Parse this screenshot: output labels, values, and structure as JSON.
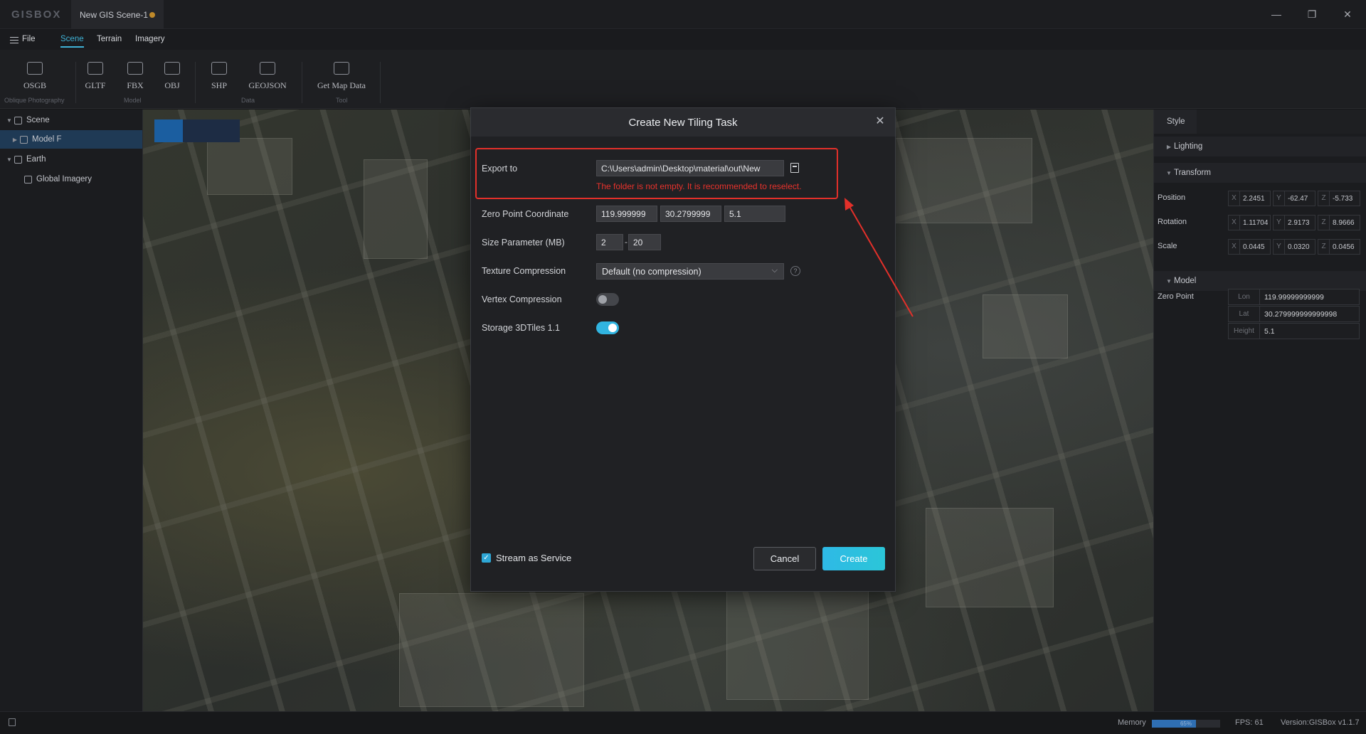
{
  "app": {
    "logo": "GISBOX",
    "doc_tab": "New GIS Scene-1",
    "window_controls": {
      "minimize": "—",
      "restore": "❐",
      "close": "✕"
    }
  },
  "menu": {
    "file": "File",
    "tabs": [
      "Scene",
      "Terrain",
      "Imagery"
    ],
    "active_tab": "Scene"
  },
  "ribbon": {
    "tools": [
      "OSGB",
      "GLTF",
      "FBX",
      "OBJ",
      "SHP",
      "GEOJSON",
      "Get Map Data"
    ],
    "groups": [
      "Oblique Photography",
      "Model",
      "Data",
      "Tool"
    ]
  },
  "tree": {
    "scene": "Scene",
    "model": "Model F",
    "earth": "Earth",
    "imagery": "Global Imagery"
  },
  "props": {
    "tab": "Style",
    "lighting": "Lighting",
    "transform": "Transform",
    "position_label": "Position",
    "rotation_label": "Rotation",
    "scale_label": "Scale",
    "position": [
      "2.2451",
      "-62.47",
      "-5.733"
    ],
    "rotation": [
      "1.11704",
      "2.9173",
      "8.9666"
    ],
    "scale": [
      "0.0445",
      "0.0320",
      "0.0456"
    ],
    "axes": [
      "X",
      "Y",
      "Z"
    ],
    "model": "Model",
    "zero_point_label": "Zero Point",
    "lon_label": "Lon",
    "lat_label": "Lat",
    "height_label": "Height",
    "lon": "119.99999999999",
    "lat": "30.279999999999998",
    "height": "5.1"
  },
  "status": {
    "memory_label": "Memory",
    "memory_percent": "65%",
    "memory_fraction": 0.65,
    "fps": "FPS: 61",
    "version": "Version:GISBox v1.1.7"
  },
  "dialog": {
    "title": "Create New Tiling Task",
    "export_label": "Export to",
    "export_path": "C:\\Users\\admin\\Desktop\\material\\out\\New",
    "error": "The folder is not empty. It is recommended to reselect.",
    "zero_point_label": "Zero Point Coordinate",
    "zero_lon": "119.999999",
    "zero_lat": "30.2799999",
    "zero_height": "5.1",
    "size_label": "Size Parameter (MB)",
    "size_min": "2",
    "size_dash": "-",
    "size_max": "20",
    "texture_label": "Texture Compression",
    "texture_value": "Default (no compression)",
    "vertex_label": "Vertex Compression",
    "vertex_on": false,
    "storage_label": "Storage 3DTiles 1.1",
    "storage_on": true,
    "stream_label": "Stream as Service",
    "stream_checked": true,
    "cancel": "Cancel",
    "create": "Create"
  },
  "colors": {
    "accent": "#31b4e0",
    "error": "#e8322c",
    "annotation": "#e3302a"
  }
}
